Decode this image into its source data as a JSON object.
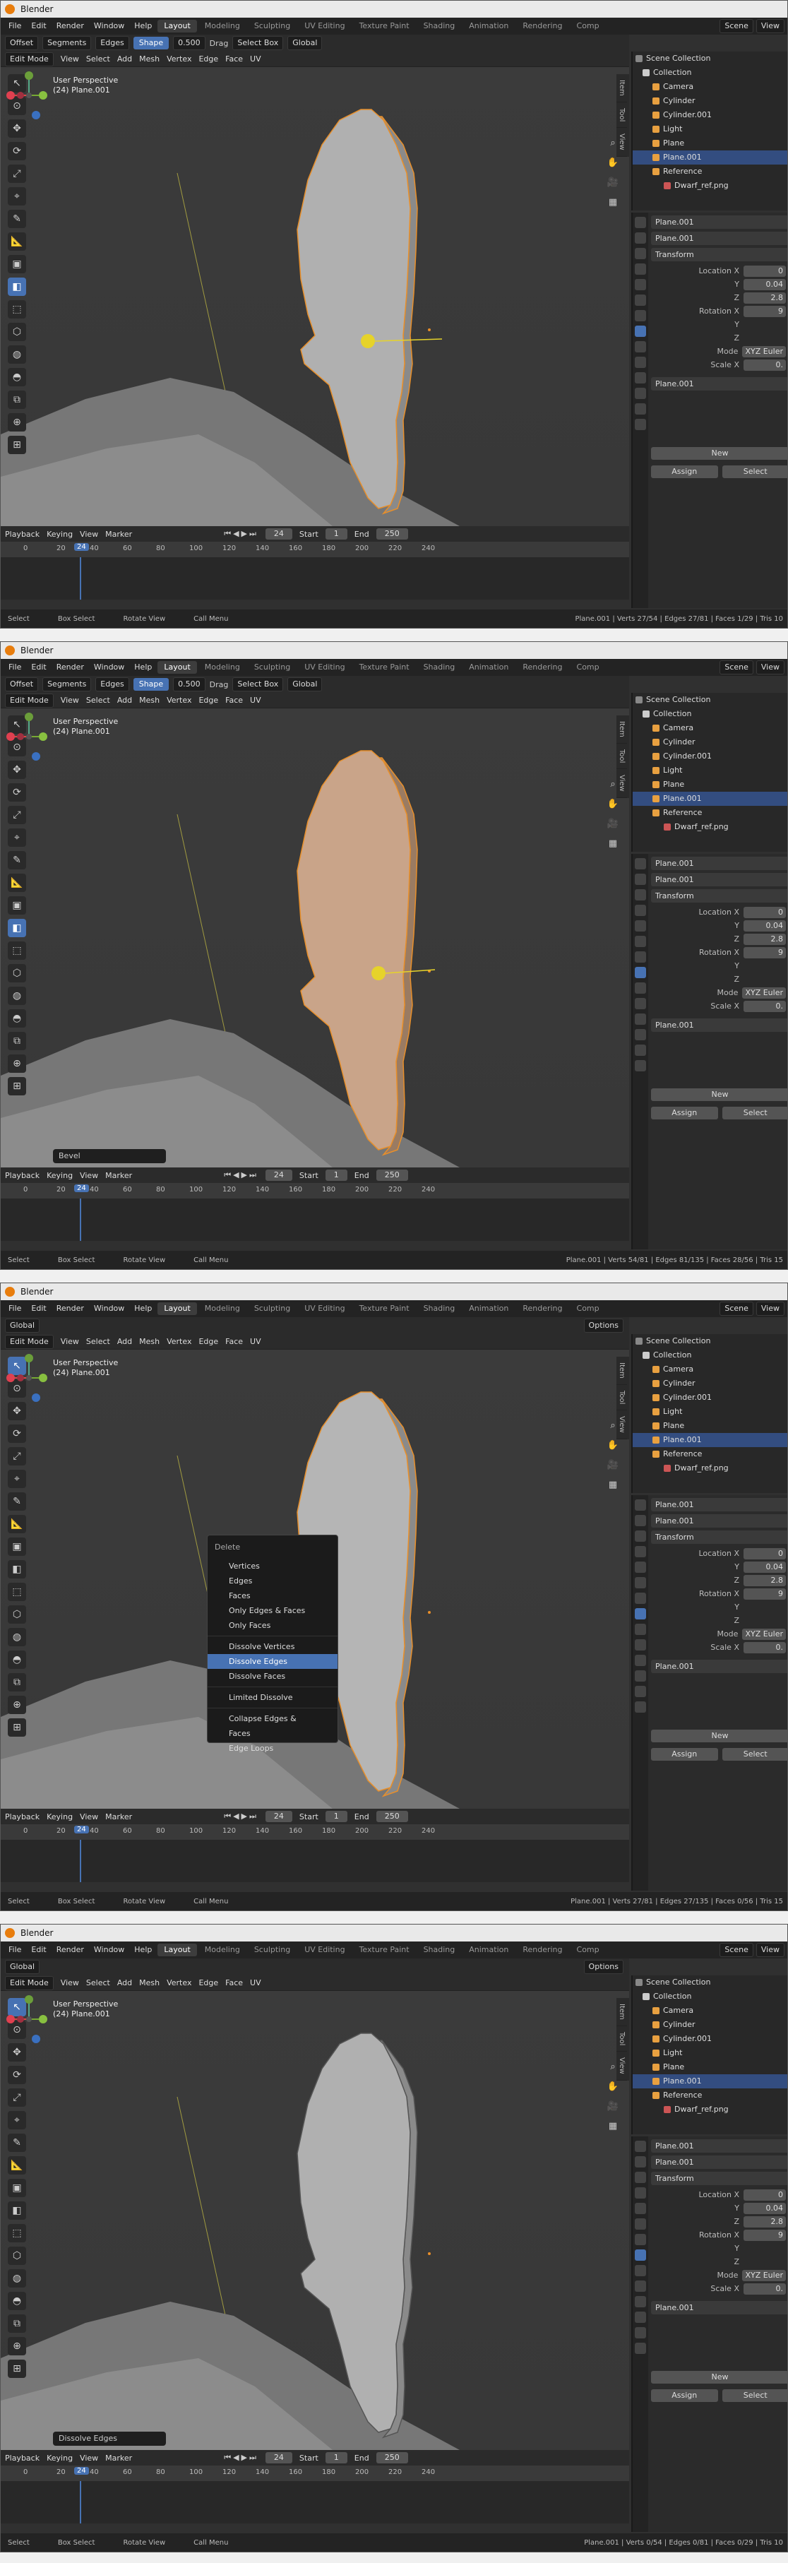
{
  "titlebar": {
    "title": "Blender"
  },
  "menu": [
    "File",
    "Edit",
    "Render",
    "Window",
    "Help"
  ],
  "workspaces": [
    "Layout",
    "Modeling",
    "Sculpting",
    "UV Editing",
    "Texture Paint",
    "Shading",
    "Animation",
    "Rendering",
    "Comp"
  ],
  "scene_label": "Scene",
  "view_layer": "View",
  "header3d": {
    "mode": "Edit Mode",
    "menus": [
      "View",
      "Select",
      "Add",
      "Mesh",
      "Vertex",
      "Edge",
      "Face",
      "UV"
    ],
    "orientation": "Global",
    "options": "Options"
  },
  "bevel_toolbar": {
    "width_type": "Offset",
    "amount_type": "Segments",
    "affect": "Edges",
    "shape_btn": "Shape",
    "shape_value": "0.500",
    "drag": "Drag",
    "select": "Select Box",
    "orient": "Global"
  },
  "viewport_info": {
    "line1": "User Perspective",
    "line2": "(24) Plane.001"
  },
  "sidetabs": [
    "Item",
    "Tool",
    "View"
  ],
  "timeline": {
    "menus": [
      "Playback",
      "Keying",
      "View",
      "Marker"
    ],
    "frame": "24",
    "start_label": "Start",
    "start": "1",
    "end_label": "End",
    "end": "250",
    "ticks": [
      "0",
      "20",
      "40",
      "60",
      "80",
      "100",
      "120",
      "140",
      "160",
      "180",
      "200",
      "220",
      "240"
    ],
    "current": "24"
  },
  "statusbar": {
    "select": "Select",
    "box": "Box Select",
    "rotate": "Rotate View",
    "call": "Call Menu"
  },
  "outliner": [
    {
      "label": "Scene Collection",
      "color": "#888888"
    },
    {
      "label": "Collection",
      "color": "#cccccc"
    },
    {
      "label": "Camera",
      "color": "#e8a040"
    },
    {
      "label": "Cylinder",
      "color": "#e8a040"
    },
    {
      "label": "Cylinder.001",
      "color": "#e8a040"
    },
    {
      "label": "Light",
      "color": "#e8a040"
    },
    {
      "label": "Plane",
      "color": "#e8a040"
    },
    {
      "label": "Plane.001",
      "color": "#e8a040"
    },
    {
      "label": "Reference",
      "color": "#e8a040"
    },
    {
      "label": "Dwarf_ref.png",
      "color": "#cc5555"
    }
  ],
  "props": {
    "object_name": "Plane.001",
    "mesh_name": "Plane.001",
    "transform": "Transform",
    "rows": [
      {
        "label": "Location X",
        "value": "0"
      },
      {
        "label": "Y",
        "value": "0.04"
      },
      {
        "label": "Z",
        "value": "2.8"
      },
      {
        "label": "Rotation X",
        "value": "9"
      },
      {
        "label": "Y",
        "value": ""
      },
      {
        "label": "Z",
        "value": ""
      },
      {
        "label": "Mode",
        "value": "XYZ Euler"
      },
      {
        "label": "Scale X",
        "value": "0."
      }
    ],
    "data_name": "Plane.001",
    "assign": "Assign",
    "select": "Select",
    "new": "New"
  },
  "windows": [
    {
      "stats": "Plane.001 | Verts 27/54 | Edges 27/81 | Faces 1/29 | Tris 10",
      "last_op": "",
      "popup": false,
      "bevel": true,
      "face_selected": false,
      "edges_selected": true
    },
    {
      "stats": "Plane.001 | Verts 54/81 | Edges 81/135 | Faces 28/56 | Tris 15",
      "last_op": "Bevel",
      "popup": false,
      "bevel": true,
      "face_selected": true,
      "edges_selected": true
    },
    {
      "stats": "Plane.001 | Verts 27/81 | Edges 27/135 | Faces 0/56 | Tris 15",
      "last_op": "",
      "popup": true,
      "bevel": false,
      "face_selected": false,
      "edges_selected": true
    },
    {
      "stats": "Plane.001 | Verts 0/54 | Edges 0/81 | Faces 0/29 | Tris 10",
      "last_op": "Dissolve Edges",
      "popup": false,
      "bevel": false,
      "face_selected": false,
      "edges_selected": false
    }
  ],
  "delete_menu": {
    "title": "Delete",
    "items": [
      "Vertices",
      "Edges",
      "Faces",
      "Only Edges & Faces",
      "Only Faces",
      "Dissolve Vertices",
      "Dissolve Edges",
      "Dissolve Faces",
      "Limited Dissolve",
      "Collapse Edges & Faces",
      "Edge Loops"
    ],
    "highlighted": "Dissolve Edges"
  }
}
